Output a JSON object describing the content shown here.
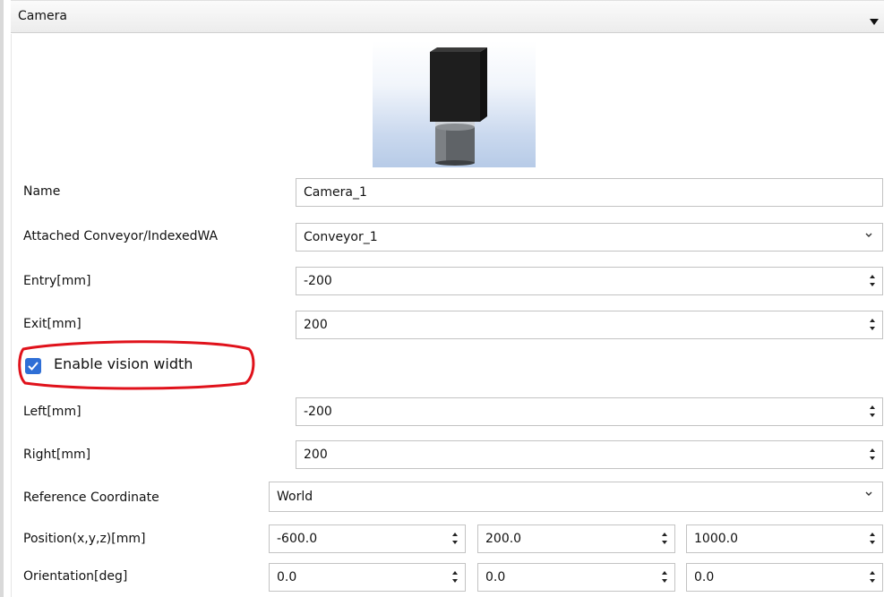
{
  "panel": {
    "title": "Camera"
  },
  "form": {
    "name": {
      "label": "Name",
      "value": "Camera_1"
    },
    "conveyor": {
      "label": "Attached Conveyor/IndexedWA",
      "value": "Conveyor_1"
    },
    "entry": {
      "label": "Entry[mm]",
      "value": "-200"
    },
    "exit": {
      "label": "Exit[mm]",
      "value": "200"
    },
    "vision_width": {
      "label": "Enable vision width",
      "checked": true
    },
    "left": {
      "label": "Left[mm]",
      "value": "-200"
    },
    "right": {
      "label": "Right[mm]",
      "value": "200"
    },
    "reference": {
      "label": "Reference Coordinate",
      "value": "World"
    },
    "position": {
      "label": "Position(x,y,z)[mm]",
      "x": "-600.0",
      "y": "200.0",
      "z": "1000.0"
    },
    "orientation": {
      "label": "Orientation[deg]",
      "x": "0.0",
      "y": "0.0",
      "z": "0.0"
    }
  },
  "colors": {
    "highlight": "#e0121b",
    "checkbox": "#2f6fd6"
  },
  "icons": [
    "camera-model-image",
    "dropdown-caret-icon",
    "spinner-icon",
    "chevron-down-icon",
    "checkbox-checked-icon"
  ]
}
